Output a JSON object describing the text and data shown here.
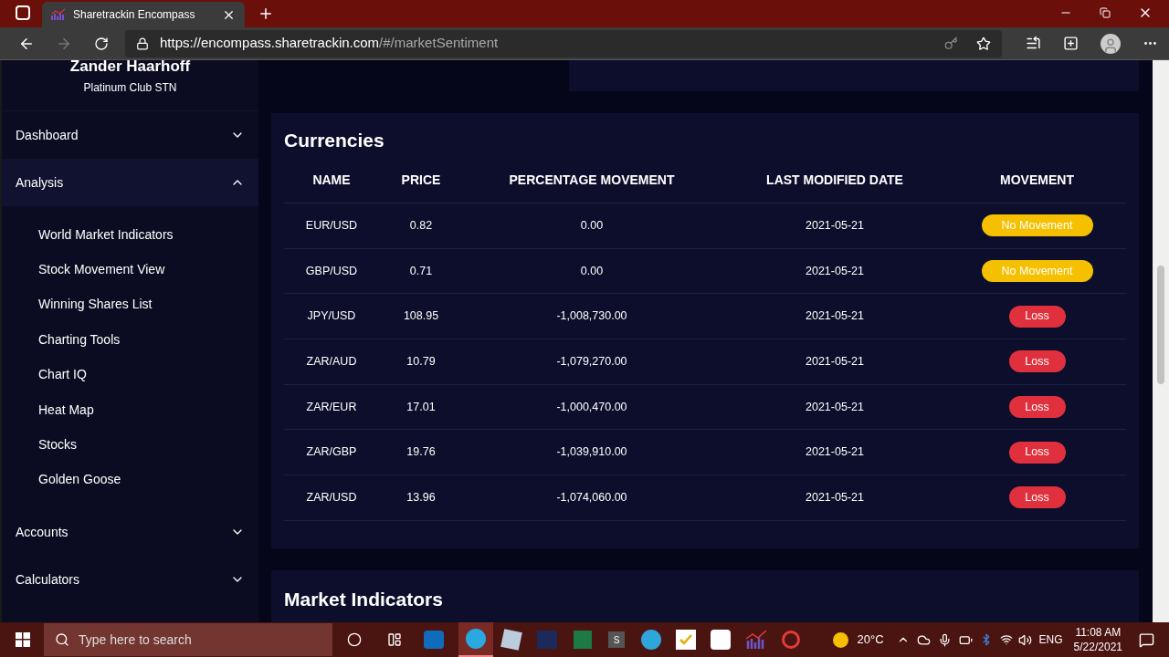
{
  "browser": {
    "tab_title": "Sharetrackin Encompass",
    "url_host": "https://encompass.sharetrackin.com",
    "url_path": "/#/marketSentiment"
  },
  "sidebar": {
    "user_name": "Zander Haarhoff",
    "user_tier": "Platinum Club STN",
    "sections": [
      {
        "label": "Dashboard",
        "expanded": false
      },
      {
        "label": "Analysis",
        "expanded": true,
        "children": [
          {
            "label": "World Market Indicators"
          },
          {
            "label": "Stock Movement View"
          },
          {
            "label": "Winning Shares List"
          },
          {
            "label": "Charting Tools"
          },
          {
            "label": "Chart IQ"
          },
          {
            "label": "Heat Map"
          },
          {
            "label": "Stocks"
          },
          {
            "label": "Golden Goose"
          }
        ]
      },
      {
        "label": "Accounts",
        "expanded": false
      },
      {
        "label": "Calculators",
        "expanded": false
      }
    ]
  },
  "currencies": {
    "title": "Currencies",
    "columns": [
      "NAME",
      "PRICE",
      "PERCENTAGE MOVEMENT",
      "LAST MODIFIED DATE",
      "MOVEMENT"
    ],
    "rows": [
      {
        "name": "EUR/USD",
        "price": "0.82",
        "percentage": "0.00",
        "date": "2021-05-21",
        "movement": "No Movement",
        "kind": "neutral"
      },
      {
        "name": "GBP/USD",
        "price": "0.71",
        "percentage": "0.00",
        "date": "2021-05-21",
        "movement": "No Movement",
        "kind": "neutral"
      },
      {
        "name": "JPY/USD",
        "price": "108.95",
        "percentage": "-1,008,730.00",
        "date": "2021-05-21",
        "movement": "Loss",
        "kind": "loss"
      },
      {
        "name": "ZAR/AUD",
        "price": "10.79",
        "percentage": "-1,079,270.00",
        "date": "2021-05-21",
        "movement": "Loss",
        "kind": "loss"
      },
      {
        "name": "ZAR/EUR",
        "price": "17.01",
        "percentage": "-1,000,470.00",
        "date": "2021-05-21",
        "movement": "Loss",
        "kind": "loss"
      },
      {
        "name": "ZAR/GBP",
        "price": "19.76",
        "percentage": "-1,039,910.00",
        "date": "2021-05-21",
        "movement": "Loss",
        "kind": "loss"
      },
      {
        "name": "ZAR/USD",
        "price": "13.96",
        "percentage": "-1,074,060.00",
        "date": "2021-05-21",
        "movement": "Loss",
        "kind": "loss"
      }
    ]
  },
  "market_indicators": {
    "title": "Market Indicators"
  },
  "taskbar": {
    "search_placeholder": "Type here to search",
    "app_letter": "S",
    "weather": "20°C",
    "language": "ENG",
    "time": "11:08 AM",
    "date": "5/22/2021"
  }
}
